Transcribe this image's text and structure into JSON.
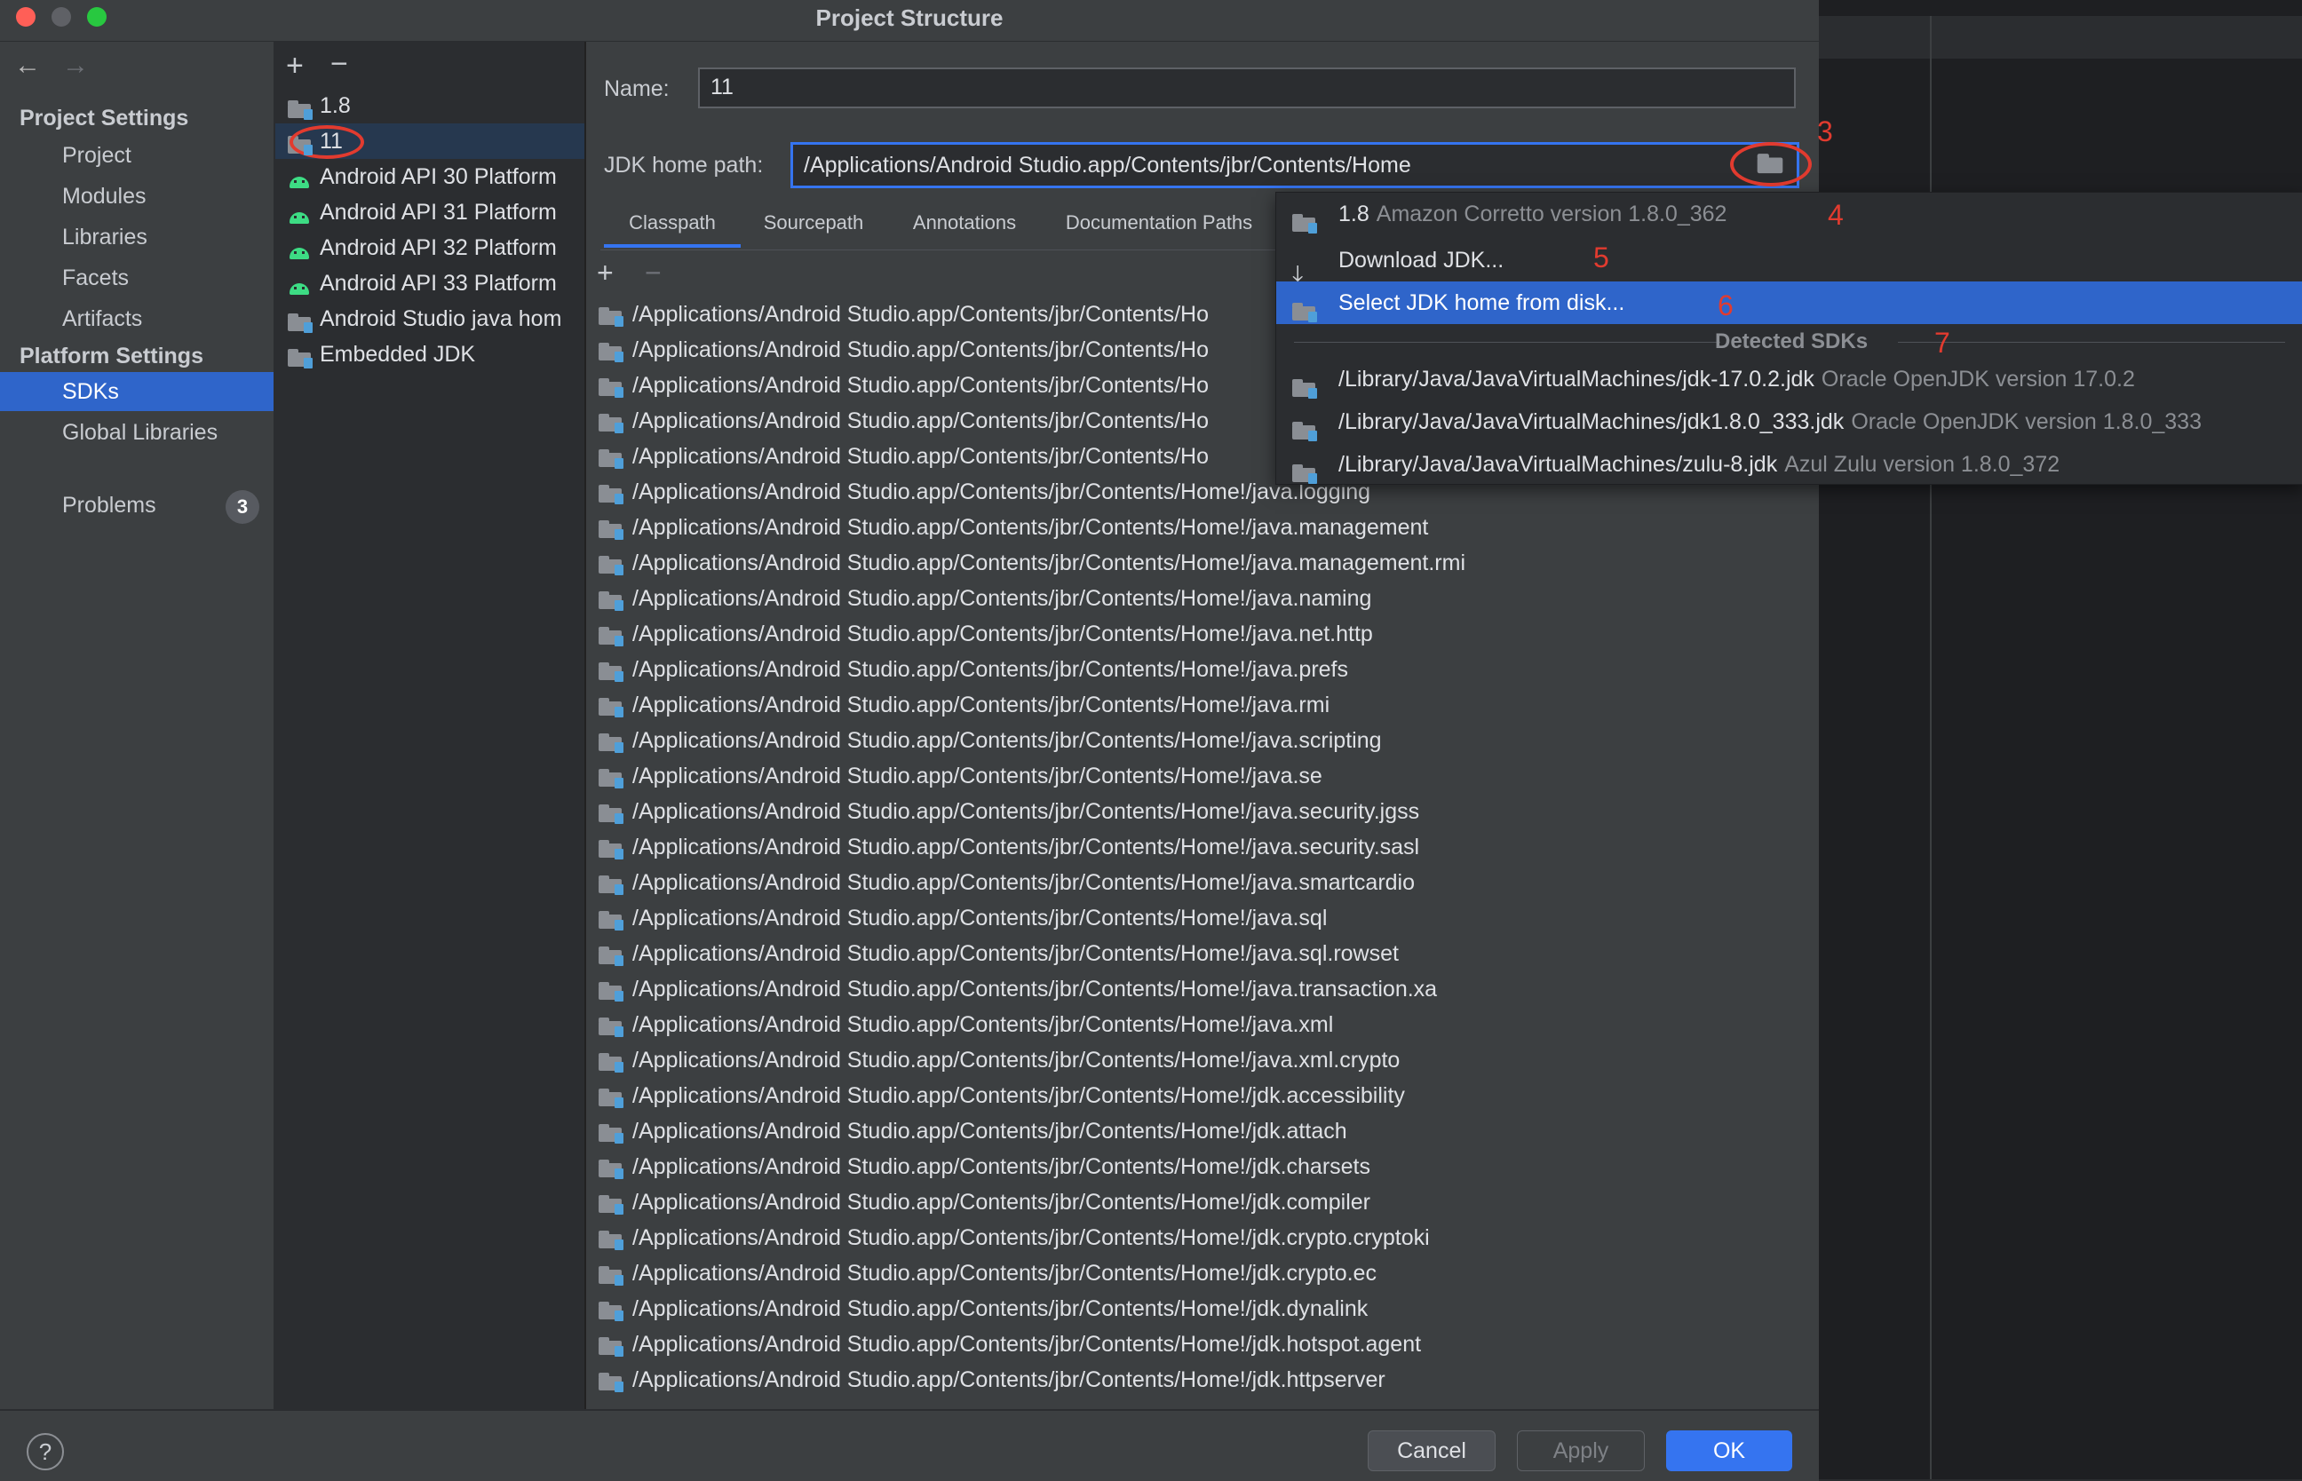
{
  "window": {
    "title": "Project Structure"
  },
  "nav": {
    "back": "←",
    "forward": "→"
  },
  "sidebar": {
    "project_settings_header": "Project Settings",
    "project_items": [
      "Project",
      "Modules",
      "Libraries",
      "Facets",
      "Artifacts"
    ],
    "platform_settings_header": "Platform Settings",
    "platform_items": [
      "SDKs",
      "Global Libraries"
    ],
    "selected": "SDKs",
    "problems": {
      "label": "Problems",
      "count": "3"
    }
  },
  "sdk_list": {
    "add": "+",
    "remove": "−",
    "items": [
      {
        "label": "1.8",
        "icon": "folder-icon"
      },
      {
        "label": "11",
        "icon": "folder-icon",
        "selected": true
      },
      {
        "label": "Android API 30 Platform",
        "icon": "android-icon"
      },
      {
        "label": "Android API 31 Platform",
        "icon": "android-icon"
      },
      {
        "label": "Android API 32 Platform",
        "icon": "android-icon"
      },
      {
        "label": "Android API 33 Platform",
        "icon": "android-icon"
      },
      {
        "label": "Android Studio java hom",
        "icon": "folder-icon"
      },
      {
        "label": "Embedded JDK",
        "icon": "folder-icon"
      }
    ]
  },
  "form": {
    "name_label": "Name:",
    "name_value": "11",
    "jdk_label": "JDK home path:",
    "jdk_value": "/Applications/Android Studio.app/Contents/jbr/Contents/Home"
  },
  "tabs": [
    "Classpath",
    "Sourcepath",
    "Annotations",
    "Documentation Paths"
  ],
  "active_tab": "Classpath",
  "classpath_toolbar": {
    "add": "+",
    "remove": "−"
  },
  "classpath": [
    "/Applications/Android Studio.app/Contents/jbr/Contents/Ho",
    "/Applications/Android Studio.app/Contents/jbr/Contents/Ho",
    "/Applications/Android Studio.app/Contents/jbr/Contents/Ho",
    "/Applications/Android Studio.app/Contents/jbr/Contents/Ho",
    "/Applications/Android Studio.app/Contents/jbr/Contents/Ho",
    "/Applications/Android Studio.app/Contents/jbr/Contents/Home!/java.logging",
    "/Applications/Android Studio.app/Contents/jbr/Contents/Home!/java.management",
    "/Applications/Android Studio.app/Contents/jbr/Contents/Home!/java.management.rmi",
    "/Applications/Android Studio.app/Contents/jbr/Contents/Home!/java.naming",
    "/Applications/Android Studio.app/Contents/jbr/Contents/Home!/java.net.http",
    "/Applications/Android Studio.app/Contents/jbr/Contents/Home!/java.prefs",
    "/Applications/Android Studio.app/Contents/jbr/Contents/Home!/java.rmi",
    "/Applications/Android Studio.app/Contents/jbr/Contents/Home!/java.scripting",
    "/Applications/Android Studio.app/Contents/jbr/Contents/Home!/java.se",
    "/Applications/Android Studio.app/Contents/jbr/Contents/Home!/java.security.jgss",
    "/Applications/Android Studio.app/Contents/jbr/Contents/Home!/java.security.sasl",
    "/Applications/Android Studio.app/Contents/jbr/Contents/Home!/java.smartcardio",
    "/Applications/Android Studio.app/Contents/jbr/Contents/Home!/java.sql",
    "/Applications/Android Studio.app/Contents/jbr/Contents/Home!/java.sql.rowset",
    "/Applications/Android Studio.app/Contents/jbr/Contents/Home!/java.transaction.xa",
    "/Applications/Android Studio.app/Contents/jbr/Contents/Home!/java.xml",
    "/Applications/Android Studio.app/Contents/jbr/Contents/Home!/java.xml.crypto",
    "/Applications/Android Studio.app/Contents/jbr/Contents/Home!/jdk.accessibility",
    "/Applications/Android Studio.app/Contents/jbr/Contents/Home!/jdk.attach",
    "/Applications/Android Studio.app/Contents/jbr/Contents/Home!/jdk.charsets",
    "/Applications/Android Studio.app/Contents/jbr/Contents/Home!/jdk.compiler",
    "/Applications/Android Studio.app/Contents/jbr/Contents/Home!/jdk.crypto.cryptoki",
    "/Applications/Android Studio.app/Contents/jbr/Contents/Home!/jdk.crypto.ec",
    "/Applications/Android Studio.app/Contents/jbr/Contents/Home!/jdk.dynalink",
    "/Applications/Android Studio.app/Contents/jbr/Contents/Home!/jdk.hotspot.agent",
    "/Applications/Android Studio.app/Contents/jbr/Contents/Home!/jdk.httpserver"
  ],
  "popup": {
    "sdk_item": {
      "name": "1.8",
      "detail": "Amazon Corretto version 1.8.0_362"
    },
    "download": "Download JDK...",
    "select_disk": "Select JDK home from disk...",
    "detected_header": "Detected SDKs",
    "detected": [
      {
        "path": "/Library/Java/JavaVirtualMachines/jdk-17.0.2.jdk",
        "detail": "Oracle OpenJDK version 17.0.2"
      },
      {
        "path": "/Library/Java/JavaVirtualMachines/jdk1.8.0_333.jdk",
        "detail": "Oracle OpenJDK version 1.8.0_333"
      },
      {
        "path": "/Library/Java/JavaVirtualMachines/zulu-8.jdk",
        "detail": "Azul Zulu version 1.8.0_372"
      }
    ]
  },
  "annotations": [
    "3",
    "4",
    "5",
    "6",
    "7"
  ],
  "footer": {
    "help": "?",
    "cancel": "Cancel",
    "apply": "Apply",
    "ok": "OK"
  },
  "colors": {
    "accent": "#2f65ca",
    "annotation": "#e23b2f",
    "dialog_bg": "#3c3f41",
    "panel_bg": "#2b2d30"
  }
}
